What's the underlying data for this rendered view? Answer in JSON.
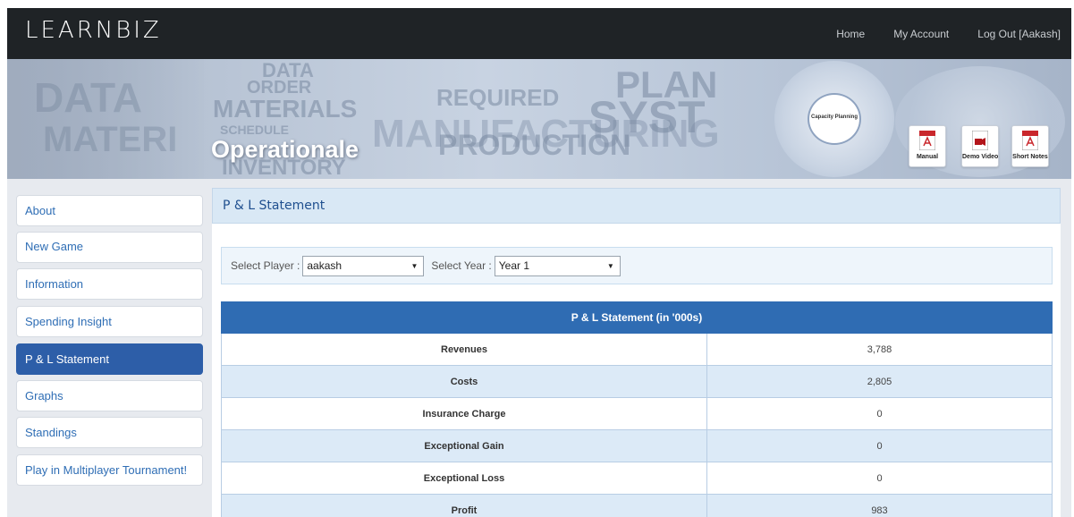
{
  "brand": "LEARNBIZ",
  "nav": {
    "home": "Home",
    "account": "My Account",
    "logout": "Log Out [Aakash]"
  },
  "banner": {
    "title": "Operationale",
    "diagram_center": "Capacity Planning",
    "docs": [
      {
        "label": "Manual",
        "icon": "pdf-icon"
      },
      {
        "label": "Demo Video",
        "icon": "video-icon"
      },
      {
        "label": "Short Notes",
        "icon": "pdf-icon"
      }
    ]
  },
  "sidebar": {
    "items": [
      {
        "label": "About"
      },
      {
        "label": "New Game"
      },
      {
        "label": "Information"
      },
      {
        "label": "Spending Insight"
      },
      {
        "label": "P & L Statement",
        "active": true
      },
      {
        "label": "Graphs"
      },
      {
        "label": "Standings"
      },
      {
        "label": "Play in Multiplayer Tournament!"
      }
    ]
  },
  "page": {
    "title": "P & L Statement",
    "player_label": "Select Player :",
    "player_value": "aakash",
    "year_label": "Select Year :",
    "year_value": "Year 1"
  },
  "table": {
    "header": "P & L Statement (in '000s)",
    "rows": [
      {
        "label": "Revenues",
        "value": "3,788"
      },
      {
        "label": "Costs",
        "value": "2,805"
      },
      {
        "label": "Insurance Charge",
        "value": "0"
      },
      {
        "label": "Exceptional Gain",
        "value": "0"
      },
      {
        "label": "Exceptional Loss",
        "value": "0"
      },
      {
        "label": "Profit",
        "value": "983"
      }
    ]
  },
  "colors": {
    "navbar": "#1f2326",
    "active": "#2d5ea8",
    "table_header": "#2f6cb3",
    "row_alt": "#dceaf7"
  }
}
